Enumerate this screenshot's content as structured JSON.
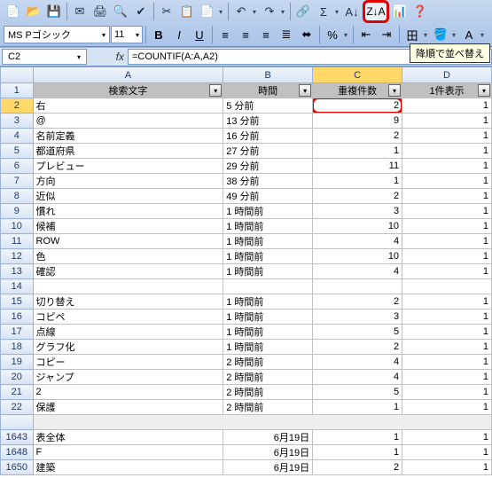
{
  "toolbar1_icons": [
    "📄",
    "📂",
    "💾",
    "✉",
    "🖨",
    "🔍",
    "✔",
    "✂",
    "📋",
    "📄",
    "↶",
    "↷",
    "🔗",
    "Σ",
    "A↓",
    "Z↓",
    "📊",
    "❓"
  ],
  "sort_desc_label": "Z↓A",
  "font": {
    "name": "MS Pゴシック",
    "size": "11"
  },
  "fmt_btns": {
    "bold": "B",
    "italic": "I",
    "underline": "U"
  },
  "align_icons": [
    "≡",
    "≡",
    "≡",
    "≣",
    "⬌"
  ],
  "money_icon": "%",
  "indent_icons": [
    "⇤",
    "⇥"
  ],
  "border_icon": "田",
  "fill_icon": "🪣",
  "fontcolor_icon": "A",
  "tooltip": "降順で並べ替え",
  "name_box": "C2",
  "fx": "fx",
  "formula": "=COUNTIF(A:A,A2)",
  "col_heads": [
    "A",
    "B",
    "C",
    "D"
  ],
  "headers": {
    "A": "検索文字",
    "B": "時間",
    "C": "重複件数",
    "D": "1件表示"
  },
  "rows": [
    {
      "n": "1"
    },
    {
      "n": "2",
      "A": "右",
      "B": "5 分前",
      "C": "2",
      "D": "1"
    },
    {
      "n": "3",
      "A": "@",
      "B": "13 分前",
      "C": "9",
      "D": "1"
    },
    {
      "n": "4",
      "A": "名前定義",
      "B": "16 分前",
      "C": "2",
      "D": "1"
    },
    {
      "n": "5",
      "A": "都道府県",
      "B": "27 分前",
      "C": "1",
      "D": "1"
    },
    {
      "n": "6",
      "A": "プレビュー",
      "B": "29 分前",
      "C": "11",
      "D": "1"
    },
    {
      "n": "7",
      "A": "方向",
      "B": "38 分前",
      "C": "1",
      "D": "1"
    },
    {
      "n": "8",
      "A": "近似",
      "B": "49 分前",
      "C": "2",
      "D": "1"
    },
    {
      "n": "9",
      "A": "慣れ",
      "B": "1 時間前",
      "C": "3",
      "D": "1"
    },
    {
      "n": "10",
      "A": "候補",
      "B": "1 時間前",
      "C": "10",
      "D": "1"
    },
    {
      "n": "11",
      "A": "ROW",
      "B": "1 時間前",
      "C": "4",
      "D": "1"
    },
    {
      "n": "12",
      "A": "色",
      "B": "1 時間前",
      "C": "10",
      "D": "1"
    },
    {
      "n": "13",
      "A": "確認",
      "B": "1 時間前",
      "C": "4",
      "D": "1"
    },
    {
      "n": "14",
      "A": "",
      "B": "",
      "C": "",
      "D": ""
    },
    {
      "n": "15",
      "A": "切り替え",
      "B": "1 時間前",
      "C": "2",
      "D": "1"
    },
    {
      "n": "16",
      "A": "コピペ",
      "B": "1 時間前",
      "C": "3",
      "D": "1"
    },
    {
      "n": "17",
      "A": "点線",
      "B": "1 時間前",
      "C": "5",
      "D": "1"
    },
    {
      "n": "18",
      "A": "グラフ化",
      "B": "1 時間前",
      "C": "2",
      "D": "1"
    },
    {
      "n": "19",
      "A": "コピー",
      "B": "2 時間前",
      "C": "4",
      "D": "1"
    },
    {
      "n": "20",
      "A": "ジャンプ",
      "B": "2 時間前",
      "C": "4",
      "D": "1"
    },
    {
      "n": "21",
      "A": "2",
      "B": "2 時間前",
      "C": "5",
      "D": "1"
    },
    {
      "n": "22",
      "A": "保護",
      "B": "2 時間前",
      "C": "1",
      "D": "1"
    }
  ],
  "gap_rows": [
    {
      "n": "1643",
      "A": "表全体",
      "B": "6月19日",
      "C": "1",
      "D": "1"
    },
    {
      "n": "1648",
      "A": "F",
      "B": "6月19日",
      "C": "1",
      "D": "1"
    },
    {
      "n": "1650",
      "A": "建築",
      "B": "6月19日",
      "C": "2",
      "D": "1"
    }
  ],
  "row13_override": {
    "A": "確認",
    "B": "1 時間前",
    "C": "4",
    "D": "1"
  }
}
